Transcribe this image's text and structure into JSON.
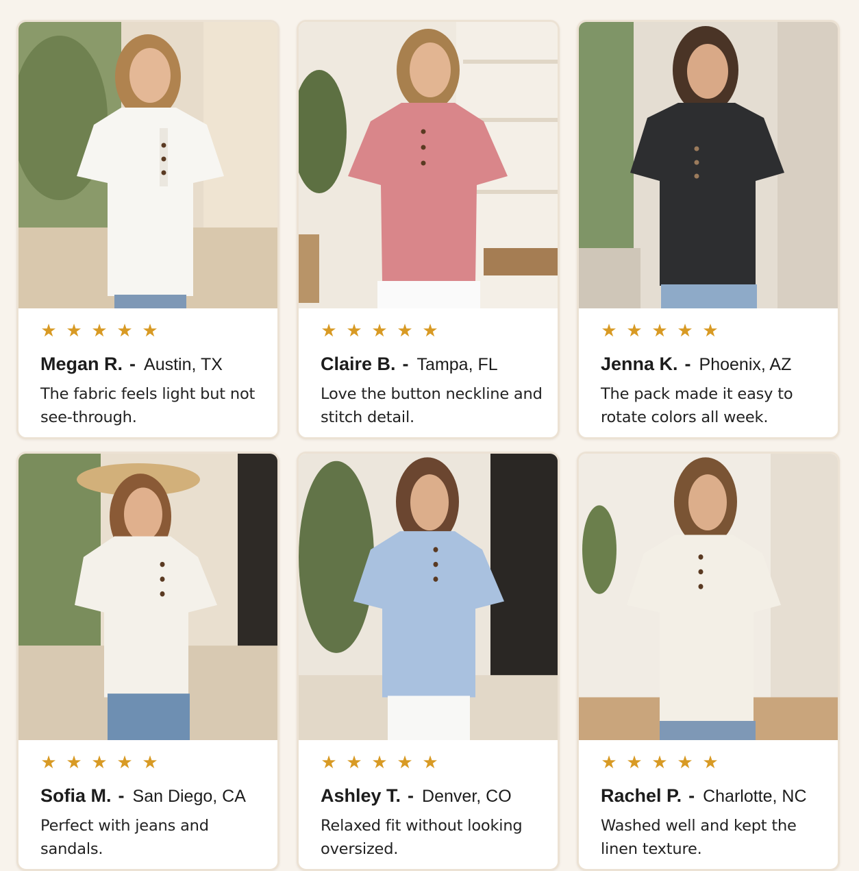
{
  "colors": {
    "background": "#f8f3ec",
    "card": "#ffffff",
    "card_border": "#ece2d4",
    "star": "#d89a24",
    "text": "#1c1c1c"
  },
  "rating_icon": "star-icon",
  "reviews": [
    {
      "rating": 5,
      "name": "Megan R.",
      "separator": "-",
      "location": "Austin, TX",
      "text": "The fabric feels light but not see-through.",
      "shirt_color": "#f7f6f2"
    },
    {
      "rating": 5,
      "name": "Claire B.",
      "separator": "-",
      "location": "Tampa, FL",
      "text": "Love the button neckline and stitch detail.",
      "shirt_color": "#d9868a"
    },
    {
      "rating": 5,
      "name": "Jenna K.",
      "separator": "-",
      "location": "Phoenix, AZ",
      "text": "The pack made it easy to rotate colors all week.",
      "shirt_color": "#2d2e30"
    },
    {
      "rating": 5,
      "name": "Sofia M.",
      "separator": "-",
      "location": "San Diego, CA",
      "text": "Perfect with jeans and sandals.",
      "shirt_color": "#f4f1ea"
    },
    {
      "rating": 5,
      "name": "Ashley T.",
      "separator": "-",
      "location": "Denver, CO",
      "text": "Relaxed fit without looking oversized.",
      "shirt_color": "#a9c1df"
    },
    {
      "rating": 5,
      "name": "Rachel P.",
      "separator": "-",
      "location": "Charlotte, NC",
      "text": "Washed well and kept the linen texture.",
      "shirt_color": "#f3efe6"
    }
  ]
}
